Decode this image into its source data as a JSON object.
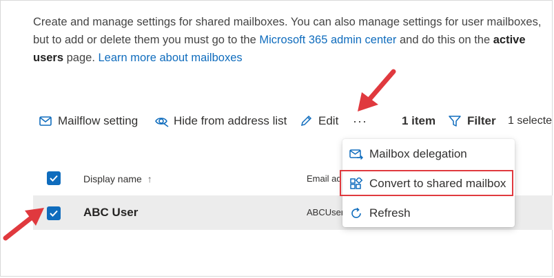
{
  "description": {
    "line1_pre": "Create and manage settings for shared mailboxes. You can also manage settings for user mailboxes, but to add or delete them you must go to the ",
    "link_admin": "Microsoft 365 admin center",
    "line_mid": " and do this on the ",
    "active_users": "active users",
    "line_post": " page. ",
    "link_learn": "Learn more about mailboxes"
  },
  "toolbar": {
    "mailflow": "Mailflow setting",
    "hide": "Hide from address list",
    "edit": "Edit",
    "more": "···",
    "item_count": "1 item",
    "filter": "Filter",
    "selected": "1 selecte"
  },
  "grid": {
    "col_display_name": "Display name",
    "sort_glyph": "↑",
    "col_email": "Email ad",
    "rows": [
      {
        "display_name": "ABC User",
        "email": "ABCUser"
      }
    ]
  },
  "menu": {
    "items": [
      {
        "label": "Mailbox delegation",
        "icon": "mail-arrow-icon"
      },
      {
        "label": "Convert to shared mailbox",
        "icon": "convert-app-icon"
      },
      {
        "label": "Refresh",
        "icon": "refresh-icon"
      }
    ]
  },
  "colors": {
    "accent": "#0f6cbd",
    "annotation_red": "#e0393e",
    "selected_row": "#ececec"
  }
}
